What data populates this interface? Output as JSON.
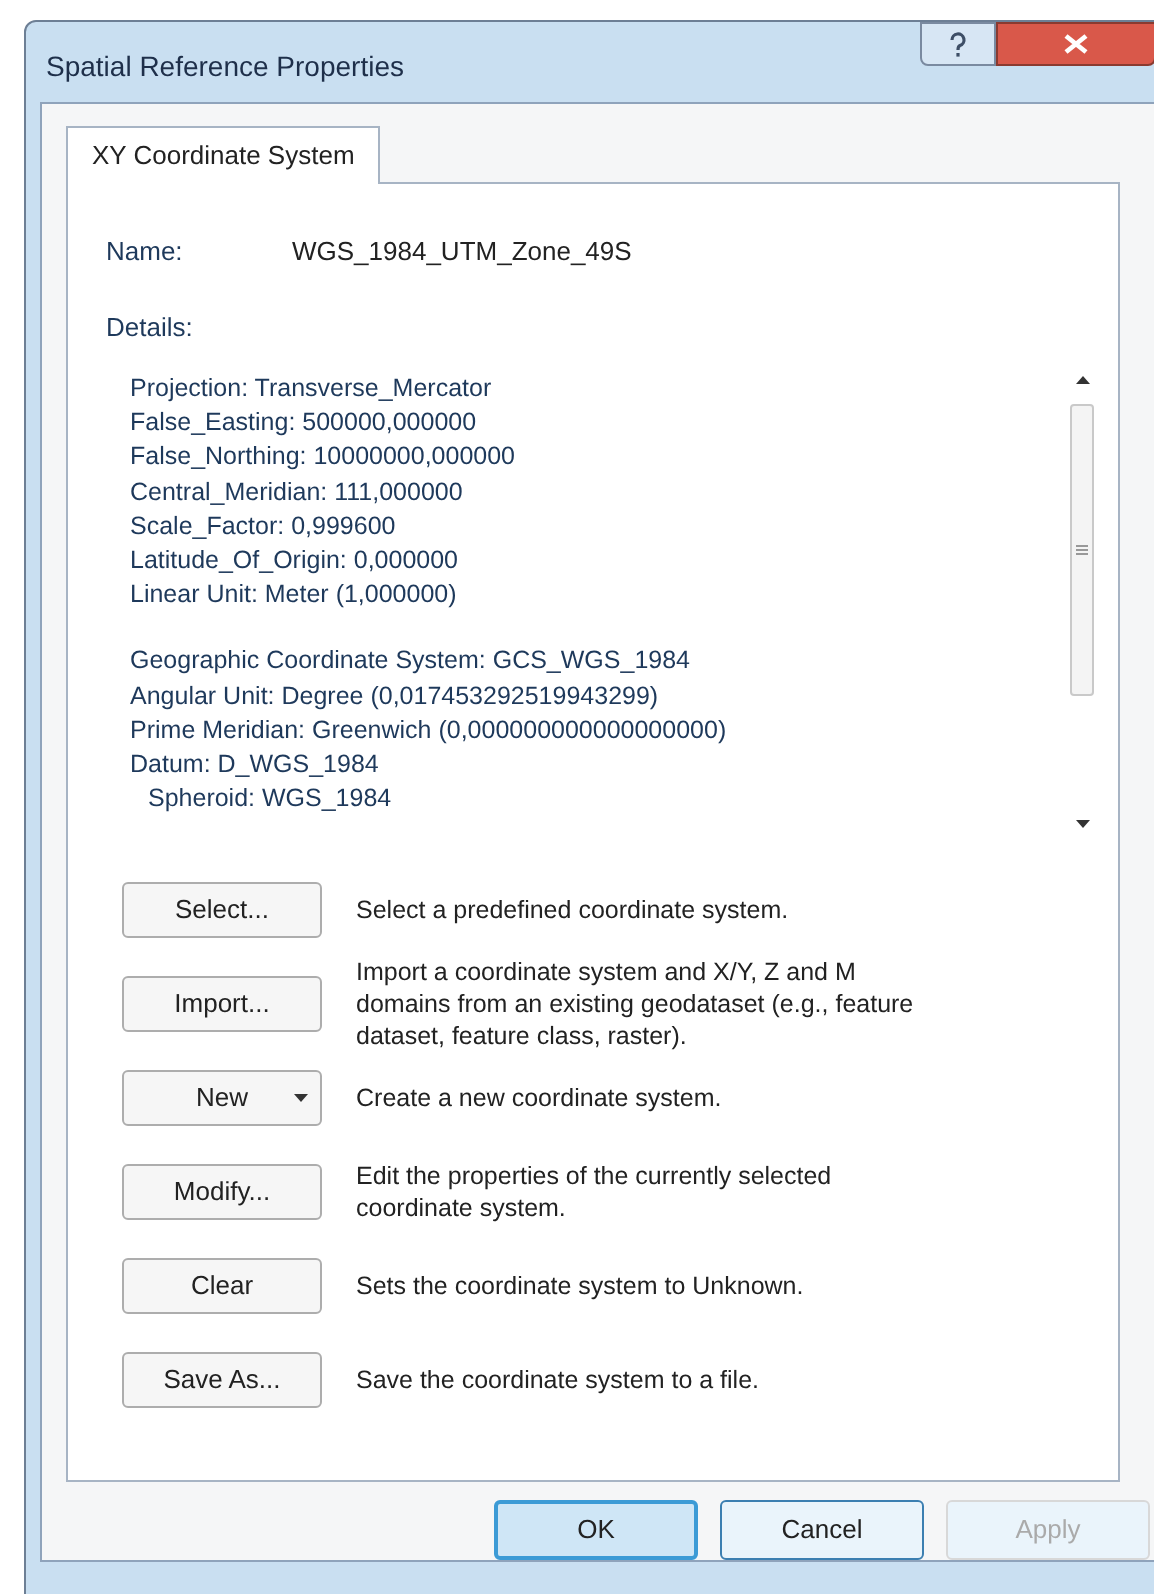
{
  "window": {
    "title": "Spatial Reference Properties"
  },
  "tabs": [
    {
      "label": "XY Coordinate System",
      "selected": true
    }
  ],
  "name": {
    "label": "Name:",
    "value": "WGS_1984_UTM_Zone_49S"
  },
  "details": {
    "label": "Details:",
    "groups": [
      [
        {
          "text": "Projection: Transverse_Mercator",
          "indented": false
        },
        {
          "text": "False_Easting: 500000,000000",
          "indented": false
        },
        {
          "text": "False_Northing: 10000000,000000",
          "indented": false
        },
        {
          "text": "Central_Meridian: 111,000000",
          "indented": false
        },
        {
          "text": "Scale_Factor: 0,999600",
          "indented": false
        },
        {
          "text": "Latitude_Of_Origin: 0,000000",
          "indented": false
        },
        {
          "text": "Linear Unit: Meter (1,000000)",
          "indented": false
        }
      ],
      [
        {
          "text": "Geographic Coordinate System: GCS_WGS_1984",
          "indented": false
        },
        {
          "text": "Angular Unit: Degree (0,017453292519943299)",
          "indented": false
        },
        {
          "text": "Prime Meridian: Greenwich (0,000000000000000000)",
          "indented": false
        },
        {
          "text": "Datum: D_WGS_1984",
          "indented": false
        },
        {
          "text": "Spheroid: WGS_1984",
          "indented": true
        }
      ]
    ]
  },
  "actions": [
    {
      "kind": "button",
      "label": "Select...",
      "description": "Select a predefined coordinate system."
    },
    {
      "kind": "button",
      "label": "Import...",
      "description": "Import a coordinate system and X/Y, Z and M domains from an existing geodataset (e.g., feature dataset, feature class, raster)."
    },
    {
      "kind": "dropdown",
      "label": "New",
      "description": "Create a new coordinate system."
    },
    {
      "kind": "button",
      "label": "Modify...",
      "description": "Edit the properties of the currently selected coordinate system."
    },
    {
      "kind": "button",
      "label": "Clear",
      "description": "Sets the coordinate system to Unknown."
    },
    {
      "kind": "button",
      "label": "Save As...",
      "description": "Save the coordinate system to a file."
    }
  ],
  "buttons": [
    {
      "label": "OK",
      "disabled": false,
      "default": true
    },
    {
      "label": "Cancel",
      "disabled": false,
      "default": false
    },
    {
      "label": "Apply",
      "disabled": true,
      "default": false
    }
  ]
}
